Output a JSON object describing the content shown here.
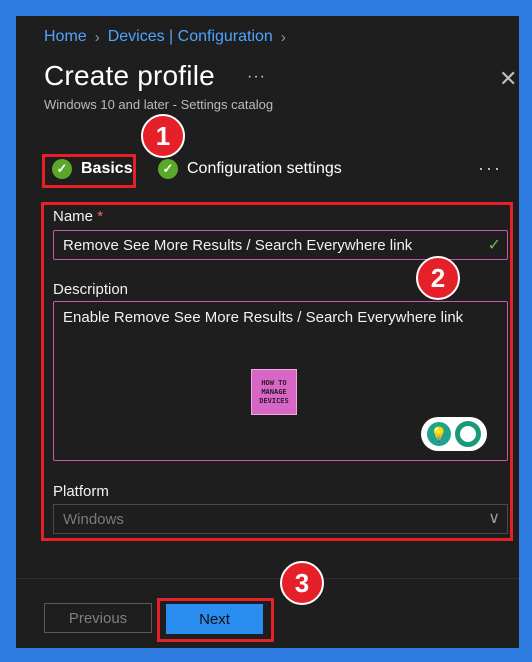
{
  "breadcrumb": [
    "Home",
    "Devices | Configuration"
  ],
  "header": {
    "title": "Create profile",
    "subtitle": "Windows 10 and later - Settings catalog",
    "more": "···",
    "close": "✕"
  },
  "tabs": [
    {
      "label": "Basics",
      "state": "complete"
    },
    {
      "label": "Configuration settings",
      "state": "complete"
    }
  ],
  "tabs_more": "···",
  "callouts": [
    "1",
    "2",
    "3"
  ],
  "form": {
    "name_label": "Name",
    "required_mark": "*",
    "name_value": "Remove See More Results / Search Everywhere link",
    "description_label": "Description",
    "description_value": "Enable Remove See More Results / Search Everywhere link",
    "platform_label": "Platform",
    "platform_value": "Windows"
  },
  "logo_text": [
    "HOW TO",
    "MANAGE",
    "DEVICES"
  ],
  "footer": {
    "previous_label": "Previous",
    "next_label": "Next"
  },
  "colors": {
    "accent": "#2a8ef0",
    "callout": "#e52028",
    "success": "#5aa829",
    "background": "#1e1e1e"
  }
}
